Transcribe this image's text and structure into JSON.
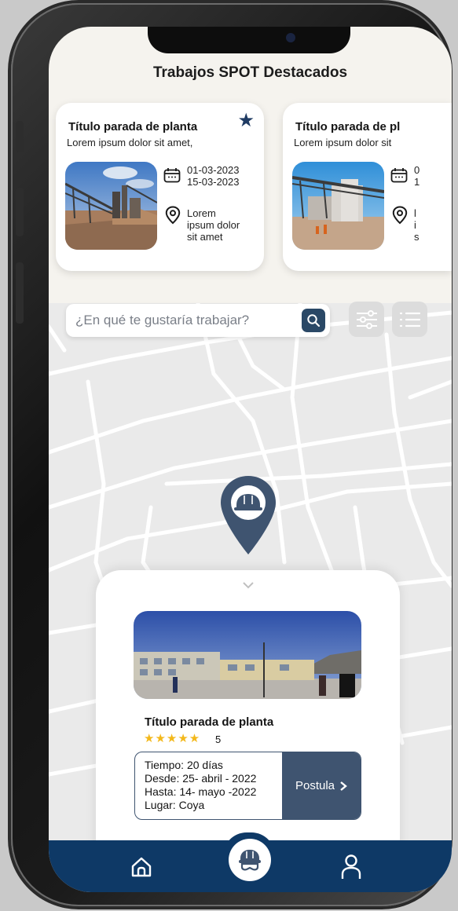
{
  "section_title": "Trabajos SPOT Destacados",
  "cards": [
    {
      "title": "Título parada de planta",
      "subtitle": "Lorem ipsum dolor sit amet,",
      "start_date": "01-03-2023",
      "end_date": "15-03-2023",
      "location_line1": "Lorem",
      "location_line2": "ipsum dolor",
      "location_line3": "sit amet",
      "favorite_icon": "star-icon"
    },
    {
      "title": "Título parada de pl",
      "subtitle": "Lorem ipsum dolor sit",
      "start_date": "0",
      "end_date": "1",
      "location_line1": "l",
      "location_line2": "i",
      "location_line3": "s"
    }
  ],
  "search": {
    "placeholder": "¿En qué te gustaría trabajar?",
    "icon": "search-icon"
  },
  "toolbar": {
    "filter_icon": "sliders-icon",
    "list_icon": "list-icon"
  },
  "detail": {
    "title": "Título parada de planta",
    "stars": "★★★★★",
    "rating": "5",
    "tiempo": "Tiempo: 20 días",
    "desde": "Desde: 25- abril - 2022",
    "hasta": "Hasta: 14- mayo -2022",
    "lugar": "Lugar: Coya",
    "apply_label": "Postula"
  },
  "nav": {
    "home_icon": "home-icon",
    "jobs_icon": "hardhat-icon",
    "profile_icon": "user-icon"
  },
  "colors": {
    "primary": "#0e3966",
    "accent": "#3f5470",
    "star": "#f3b81b",
    "background": "#f5f3ee"
  }
}
